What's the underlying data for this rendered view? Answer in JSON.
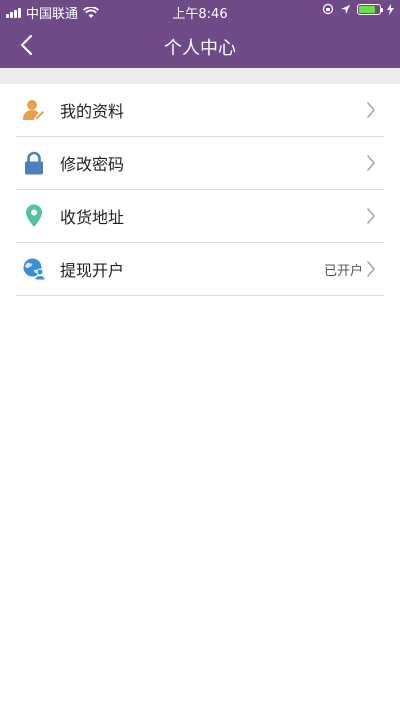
{
  "status_bar": {
    "carrier": "中国联通",
    "time": "上午8:46",
    "battery_level": 0.8
  },
  "header": {
    "title": "个人中心"
  },
  "menu": {
    "items": [
      {
        "label": "我的资料",
        "icon": "profile-edit-icon",
        "status": ""
      },
      {
        "label": "修改密码",
        "icon": "lock-icon",
        "status": ""
      },
      {
        "label": "收货地址",
        "icon": "location-pin-icon",
        "status": ""
      },
      {
        "label": "提现开户",
        "icon": "globe-user-icon",
        "status": "已开户"
      }
    ]
  },
  "colors": {
    "header_bg": "#6f4a86",
    "profile_icon": "#e9a04a",
    "lock_icon": "#4d7ec2",
    "location_icon": "#52c49a",
    "globe_icon": "#3b8fd6"
  }
}
